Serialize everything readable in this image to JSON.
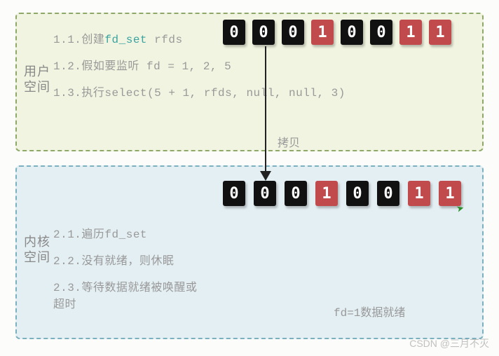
{
  "user_panel": {
    "side_label": "用户空间",
    "l1_pre": "1.1.创建",
    "l1_hl": "fd_set",
    "l1_post": " rfds",
    "l2": "1.2.假如要监听 fd = 1, 2, 5",
    "l3": "1.3.执行select(5 + 1, rfds, null, null, 3)"
  },
  "kernel_panel": {
    "side_label": "内核空间",
    "l1": "2.1.遍历fd_set",
    "l2": "2.2.没有就绪，则休眠",
    "l3": "2.3.等待数据就绪被唤醒或超时",
    "ready": "fd=1数据就绪"
  },
  "copy_label": "拷贝",
  "chart_data": {
    "type": "table",
    "description": "fd_set bit arrays before (user space) and after copy (kernel space)",
    "bit_index_order": "msb_to_lsb_index_7_to_0",
    "user_bits": [
      0,
      0,
      0,
      1,
      0,
      0,
      1,
      1
    ],
    "kernel_bits": [
      0,
      0,
      0,
      1,
      0,
      0,
      1,
      1
    ]
  },
  "watermark": "CSDN @三月不灭"
}
